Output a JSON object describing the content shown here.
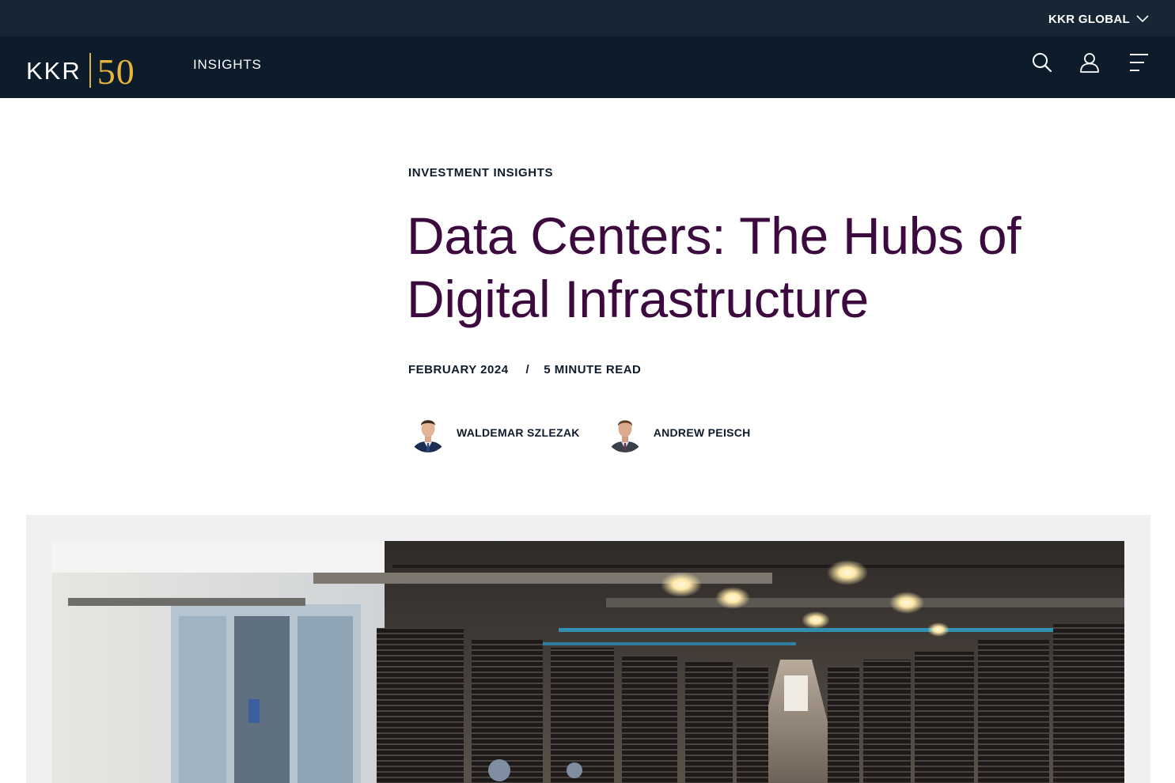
{
  "utility_bar": {
    "region_label": "KKR GLOBAL"
  },
  "nav": {
    "logo_text": "KKR",
    "logo_mark": "50",
    "section_label": "INSIGHTS",
    "icons": [
      "search-icon",
      "user-icon",
      "menu-icon"
    ]
  },
  "article": {
    "eyebrow": "INVESTMENT INSIGHTS",
    "title": "Data Centers: The Hubs of Digital Infrastructure",
    "date": "FEBRUARY 2024",
    "separator": "/",
    "read_time": "5 MINUTE READ",
    "authors": [
      {
        "name": "WALDEMAR SZLEZAK"
      },
      {
        "name": "ANDREW PEISCH"
      }
    ]
  },
  "colors": {
    "utility_bar_bg": "#172634",
    "nav_bg": "#0d1c2a",
    "title": "#3d0a3f",
    "text_dark": "#0d1c2a",
    "logo_gold": "#e6b53a",
    "hero_frame_bg": "#f0f0f2"
  }
}
